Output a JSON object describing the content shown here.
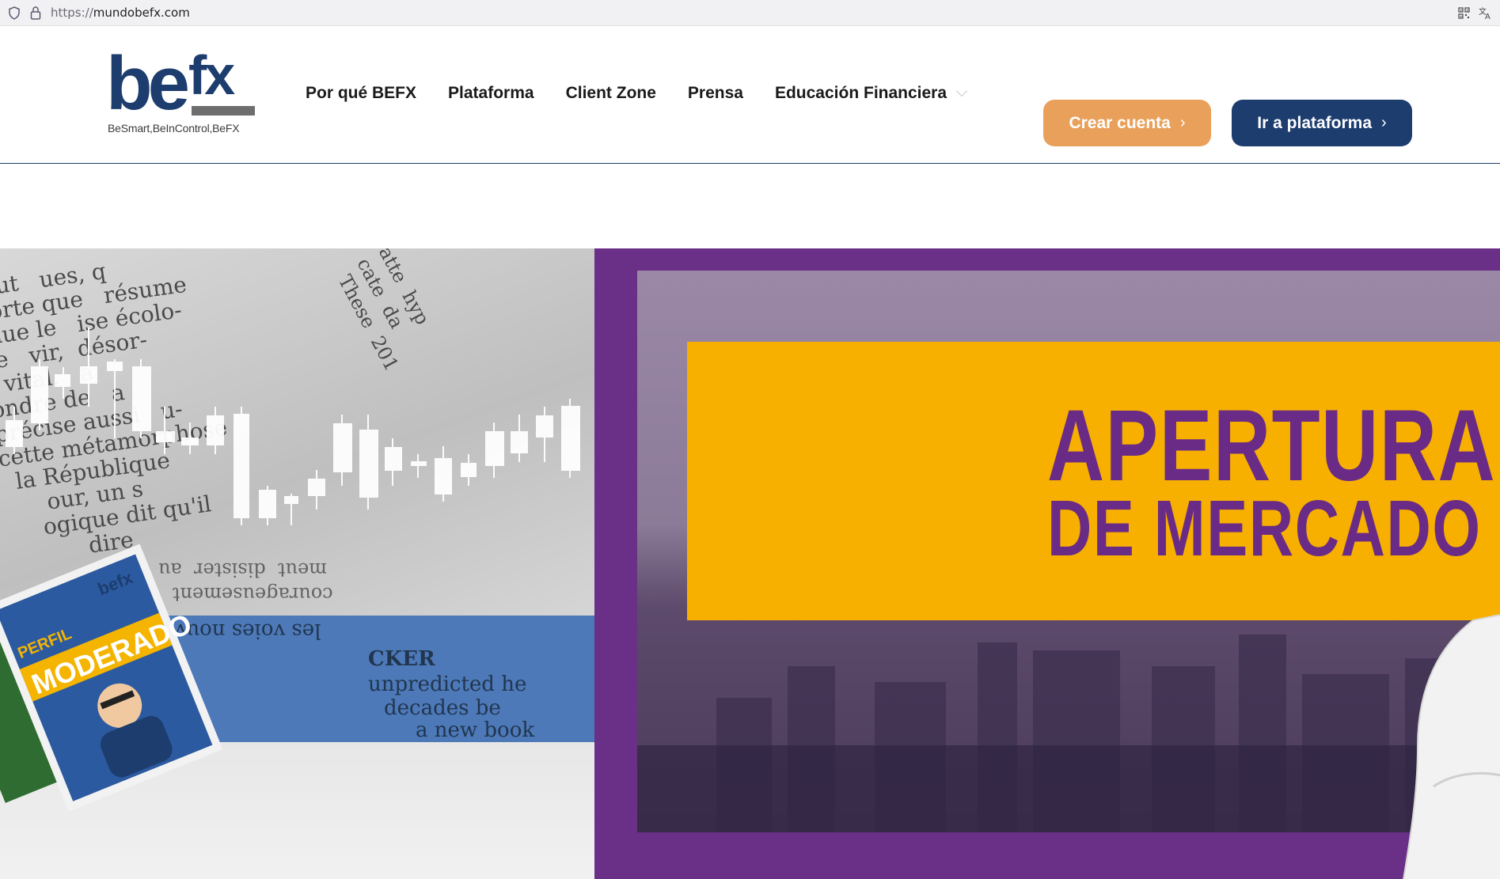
{
  "browser": {
    "url_protocol": "https://",
    "url_host": "mundobefx.com",
    "icons": [
      "shield-icon",
      "lock-icon",
      "qr-code-icon",
      "translate-icon"
    ]
  },
  "header": {
    "logo_word": "be",
    "logo_word_fx": "fx",
    "logo_tagline": "BeSmart,BeInControl,BeFX",
    "nav": [
      {
        "label": "Por qué BEFX"
      },
      {
        "label": "Plataforma"
      },
      {
        "label": "Client Zone"
      },
      {
        "label": "Prensa"
      },
      {
        "label": "Educación Financiera"
      }
    ],
    "buttons": {
      "create_account": "Crear cuenta",
      "go_platform": "Ir a plataforma",
      "arrow": "›"
    }
  },
  "hero": {
    "slide_left": {
      "magazine_brand": "befx",
      "magazine_title_1": "PERFIL",
      "magazine_title_2": "MODERADO",
      "band_word": "CKER"
    },
    "slide_right": {
      "headline_1": "APERTURA",
      "headline_2": "DE MERCADO"
    }
  },
  "colors": {
    "brand_navy": "#1d3d6e",
    "brand_orange": "#e9a05b",
    "slide_purple": "#6a2f86",
    "slide_yellow": "#f7b000"
  }
}
